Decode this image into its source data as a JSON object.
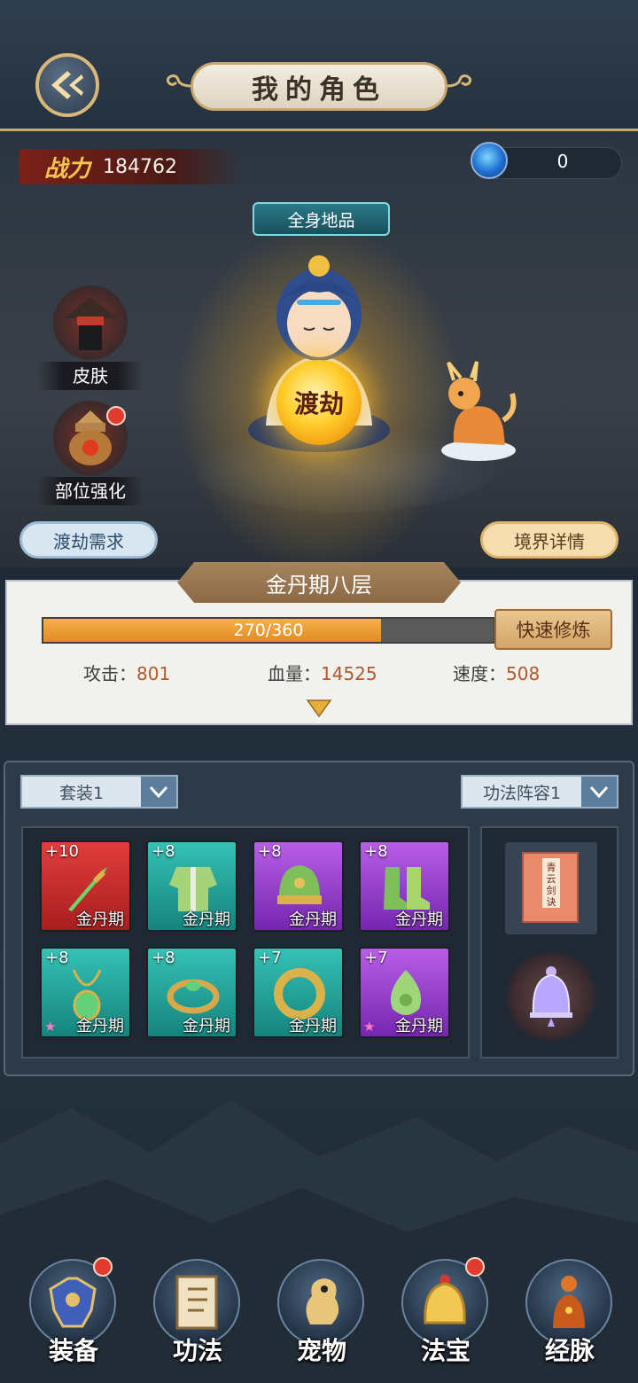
{
  "header": {
    "title": "我的角色"
  },
  "combat": {
    "label": "战力",
    "value": "184762"
  },
  "currency": {
    "value": "0",
    "icon": "blue-orb-icon"
  },
  "character": {
    "grade_banner": "全身地品",
    "crossing_button": "渡劫"
  },
  "side_menu": [
    {
      "label": "皮肤",
      "icon": "hat-icon",
      "badge": false
    },
    {
      "label": "部位强化",
      "icon": "furnace-icon",
      "badge": true
    }
  ],
  "buttons": {
    "requirement": "渡劫需求",
    "realm_details": "境界详情",
    "quick_cultivate": "快速修炼"
  },
  "realm": {
    "name": "金丹期八层",
    "progress_text": "270/360",
    "progress_current": 270,
    "progress_max": 360,
    "stats": [
      {
        "label": "攻击：",
        "value": "801"
      },
      {
        "label": "血量：",
        "value": "14525"
      },
      {
        "label": "速度：",
        "value": "508"
      }
    ]
  },
  "equipment": {
    "set_select": "套装1",
    "formation_select": "功法阵容1",
    "items": [
      {
        "level": "+10",
        "tier": "金丹期",
        "rarity": "red",
        "icon": "sword-icon",
        "star": false
      },
      {
        "level": "+8",
        "tier": "金丹期",
        "rarity": "teal",
        "icon": "robe-icon",
        "star": false
      },
      {
        "level": "+8",
        "tier": "金丹期",
        "rarity": "purple",
        "icon": "helmet-icon",
        "star": false
      },
      {
        "level": "+8",
        "tier": "金丹期",
        "rarity": "purple",
        "icon": "boots-icon",
        "star": false
      },
      {
        "level": "+8",
        "tier": "金丹期",
        "rarity": "teal",
        "icon": "amulet-icon",
        "star": true
      },
      {
        "level": "+8",
        "tier": "金丹期",
        "rarity": "teal",
        "icon": "bracelet-icon",
        "star": false
      },
      {
        "level": "+7",
        "tier": "金丹期",
        "rarity": "teal",
        "icon": "ring-icon",
        "star": false
      },
      {
        "level": "+7",
        "tier": "金丹期",
        "rarity": "purple",
        "icon": "jade-pendant-icon",
        "star": true
      }
    ],
    "manual_book": {
      "title": "青云剑诀",
      "icon": "book-icon"
    },
    "treasure": {
      "icon": "bell-icon"
    }
  },
  "bottom_nav": [
    {
      "label": "装备",
      "icon": "armor-icon",
      "badge": true
    },
    {
      "label": "功法",
      "icon": "scroll-book-icon",
      "badge": false
    },
    {
      "label": "宠物",
      "icon": "seahorse-pet-icon",
      "badge": false
    },
    {
      "label": "法宝",
      "icon": "golden-bell-icon",
      "badge": true
    },
    {
      "label": "经脉",
      "icon": "meridian-figure-icon",
      "badge": false
    }
  ],
  "colors": {
    "accent_gold": "#c9a96a",
    "progress_fill": "#e28a22",
    "badge_red": "#e23b2e",
    "rarity_red": "#c22a2a",
    "rarity_teal": "#1f9e94",
    "rarity_purple": "#9840cc"
  }
}
